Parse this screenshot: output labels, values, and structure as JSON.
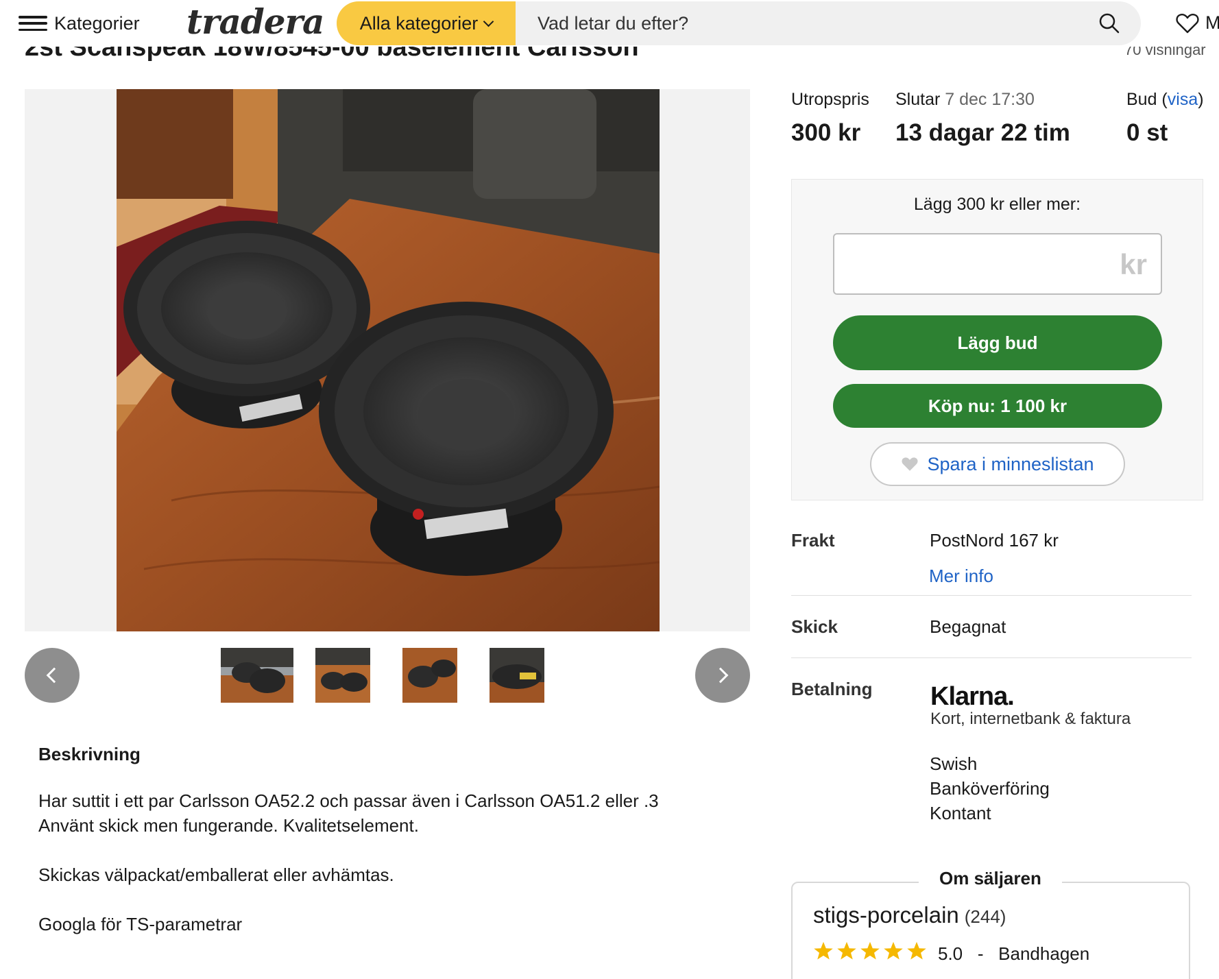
{
  "header": {
    "menu_label": "Kategorier",
    "logo_text": "tradera",
    "category_select": "Alla kategorier",
    "search_placeholder": "Vad letar du efter?",
    "right_cut_text": "M"
  },
  "listing": {
    "title_cut": "2st Scanspeak 18W/8545-00 baselement Carlsson",
    "views_cut": "70 visningar"
  },
  "auction": {
    "start_price_label": "Utropspris",
    "start_price": "300 kr",
    "ends_label": "Slutar",
    "ends_date": "7 dec 17:30",
    "time_left": "13 dagar 22 tim",
    "bids_label": "Bud",
    "bids_show_link": "visa",
    "bids_count": "0 st"
  },
  "bid_box": {
    "prompt": "Lägg 300 kr eller mer:",
    "input_value": "",
    "currency_suffix": "kr",
    "place_bid_label": "Lägg bud",
    "buy_now_label": "Köp nu: 1 100 kr",
    "save_label": "Spara i minneslistan"
  },
  "details": {
    "shipping_label": "Frakt",
    "shipping_value": "PostNord 167 kr",
    "shipping_more": "Mer info",
    "condition_label": "Skick",
    "condition_value": "Begagnat",
    "payment_label": "Betalning",
    "klarna_logo": "Klarna.",
    "klarna_sub": "Kort, internetbank & faktura",
    "payment_methods": [
      "Swish",
      "Banköverföring",
      "Kontant"
    ]
  },
  "description": {
    "heading": "Beskrivning",
    "lines": [
      "Har suttit i ett par Carlsson OA52.2 och passar även i Carlsson OA51.2 eller .3",
      "Använt skick men fungerande. Kvalitetselement.",
      "Skickas välpackat/emballerat eller avhämtas.",
      "Googla för TS-parametrar"
    ]
  },
  "seller": {
    "heading": "Om säljaren",
    "name": "stigs-porcelain",
    "count": "(244)",
    "rating": "5.0",
    "separator": "-",
    "location": "Bandhagen",
    "stars": 5
  },
  "colors": {
    "accent_yellow": "#f9c942",
    "button_green": "#2d8132",
    "link_blue": "#1f63c6",
    "star_yellow": "#f5b800"
  },
  "icons": [
    "menu-icon",
    "search-icon",
    "heart-icon",
    "chevron-left-icon",
    "chevron-right-icon",
    "star-icon"
  ]
}
